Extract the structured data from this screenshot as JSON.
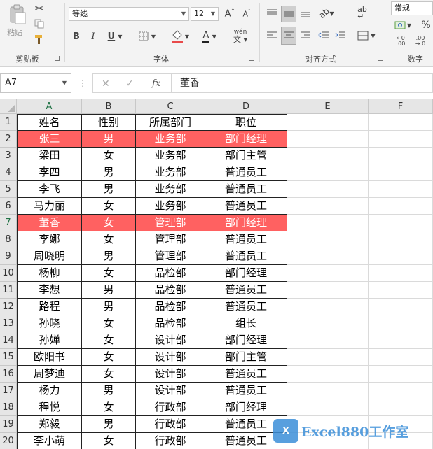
{
  "ribbon": {
    "clipboard": {
      "paste_label": "粘贴",
      "group_label": "剪贴板"
    },
    "font": {
      "font_name": "等线",
      "font_size": "12",
      "bold": "B",
      "italic": "I",
      "underline": "U",
      "font_color_letter": "A",
      "phonetic": "wén",
      "group_label": "字体"
    },
    "alignment": {
      "group_label": "对齐方式"
    },
    "number": {
      "format": "常规",
      "percent": "%",
      "group_label": "数字"
    }
  },
  "formula_bar": {
    "name_box": "A7",
    "fx": "fx",
    "content": "董香"
  },
  "columns": [
    "A",
    "B",
    "C",
    "D",
    "E",
    "F"
  ],
  "table": {
    "headers": [
      "姓名",
      "性别",
      "所属部门",
      "职位"
    ],
    "rows": [
      [
        "张三",
        "男",
        "业务部",
        "部门经理"
      ],
      [
        "梁田",
        "女",
        "业务部",
        "部门主管"
      ],
      [
        "李四",
        "男",
        "业务部",
        "普通员工"
      ],
      [
        "李飞",
        "男",
        "业务部",
        "普通员工"
      ],
      [
        "马力丽",
        "女",
        "业务部",
        "普通员工"
      ],
      [
        "董香",
        "女",
        "管理部",
        "部门经理"
      ],
      [
        "李娜",
        "女",
        "管理部",
        "普通员工"
      ],
      [
        "周晓明",
        "男",
        "管理部",
        "普通员工"
      ],
      [
        "杨柳",
        "女",
        "品检部",
        "部门经理"
      ],
      [
        "李想",
        "男",
        "品检部",
        "普通员工"
      ],
      [
        "路程",
        "男",
        "品检部",
        "普通员工"
      ],
      [
        "孙晓",
        "女",
        "品检部",
        "组长"
      ],
      [
        "孙婵",
        "女",
        "设计部",
        "部门经理"
      ],
      [
        "欧阳书",
        "女",
        "设计部",
        "部门主管"
      ],
      [
        "周梦迪",
        "女",
        "设计部",
        "普通员工"
      ],
      [
        "杨力",
        "男",
        "设计部",
        "普通员工"
      ],
      [
        "程悦",
        "女",
        "行政部",
        "部门经理"
      ],
      [
        "郑毅",
        "男",
        "行政部",
        "普通员工"
      ],
      [
        "李小萌",
        "女",
        "行政部",
        "普通员工"
      ]
    ],
    "row_numbers": [
      "1",
      "2",
      "3",
      "4",
      "5",
      "6",
      "7",
      "8",
      "9",
      "10",
      "11",
      "12",
      "13",
      "14",
      "15",
      "16",
      "17",
      "18",
      "19",
      "20"
    ]
  },
  "colors": {
    "highlight": "#ff6161",
    "watermark": "#3b8fd9"
  },
  "watermark": {
    "logo": "X",
    "text": "Excel880工作室"
  }
}
